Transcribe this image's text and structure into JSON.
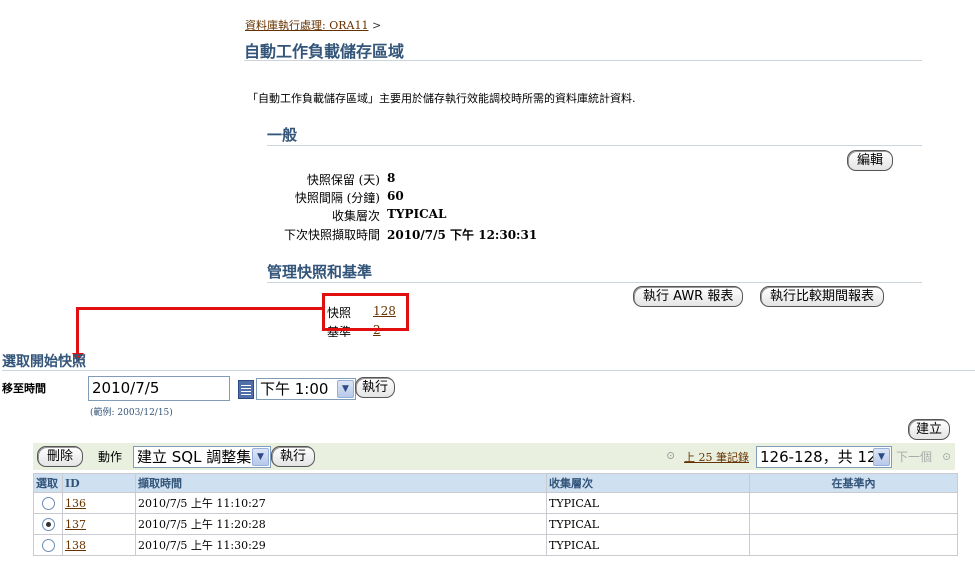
{
  "breadcrumb": {
    "link": "資料庫執行處理: ORA11",
    "sep": ">"
  },
  "page_title": "自動工作負載儲存區域",
  "description": "「自動工作負載儲存區域」主要用於儲存執行效能調校時所需的資料庫統計資料.",
  "general": {
    "heading": "一般",
    "edit_button": "編輯",
    "rows": [
      {
        "label": "快照保留 (天)",
        "value": "8"
      },
      {
        "label": "快照間隔 (分鐘)",
        "value": "60"
      },
      {
        "label": "收集層次",
        "value": "TYPICAL"
      },
      {
        "label": "下次快照擷取時間",
        "value": "2010/7/5 下午 12:30:31"
      }
    ]
  },
  "manage": {
    "heading": "管理快照和基準",
    "awr_button": "執行 AWR 報表",
    "compare_button": "執行比較期間報表",
    "snapshot_label": "快照",
    "snapshot_value": "128",
    "baseline_label": "基準",
    "baseline_value": "2"
  },
  "select_snapshot": {
    "heading": "選取開始快照",
    "goto_label": "移至時間",
    "date_value": "2010/7/5",
    "date_example": "(範例: 2003/12/15)",
    "time_value": "下午 1:00",
    "go_button": "執行",
    "create_button": "建立"
  },
  "toolbar": {
    "delete_button": "刪除",
    "action_label": "動作",
    "action_value": "建立 SQL 調整集",
    "go_button": "執行",
    "prev_link": "上 25 筆記錄",
    "range_value": "126-128，共 128",
    "next_label": "下一個"
  },
  "table": {
    "headers": [
      "選取",
      "ID",
      "擷取時間",
      "收集層次",
      "在基準內"
    ],
    "rows": [
      {
        "selected": false,
        "id": "136",
        "time": "2010/7/5 上午 11:10:27",
        "level": "TYPICAL",
        "baseline": ""
      },
      {
        "selected": true,
        "id": "137",
        "time": "2010/7/5 上午 11:20:28",
        "level": "TYPICAL",
        "baseline": ""
      },
      {
        "selected": false,
        "id": "138",
        "time": "2010/7/5 上午 11:30:29",
        "level": "TYPICAL",
        "baseline": ""
      }
    ]
  },
  "colors": {
    "accent": "#33557a",
    "link": "#663300",
    "highlight": "#e01010",
    "header_bg": "#cfe0f1"
  }
}
